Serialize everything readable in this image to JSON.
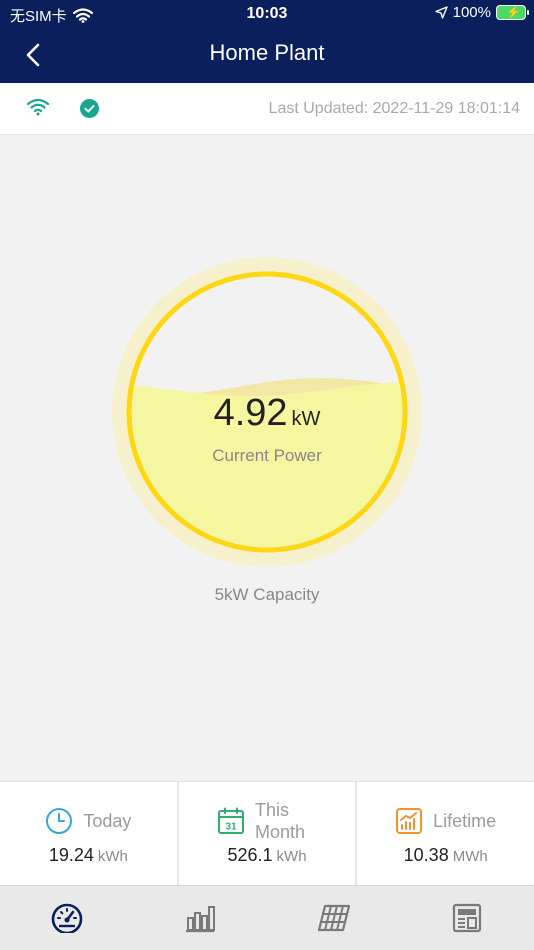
{
  "status_bar": {
    "carrier": "无SIM卡",
    "time": "10:03",
    "battery": "100%"
  },
  "header": {
    "title": "Home Plant",
    "back_icon": "chevron-left-icon"
  },
  "info_row": {
    "wifi_icon": "wifi-icon",
    "status_icon": "check-circle-icon",
    "last_updated": "Last Updated: 2022-11-29 18:01:14"
  },
  "gauge": {
    "value": "4.92",
    "unit": "kW",
    "label": "Current Power",
    "capacity": "5kW Capacity",
    "fill_fraction": 0.6,
    "ring_color": "#fcd712",
    "fill_color": "#f5f6a0"
  },
  "stats": [
    {
      "icon": "clock-icon",
      "label": "Today",
      "value": "19.24",
      "unit": "kWh",
      "color": "#35a9d4"
    },
    {
      "icon": "calendar-icon",
      "label": "This Month",
      "value": "526.1",
      "unit": "kWh",
      "color": "#2fae6e"
    },
    {
      "icon": "trending-chart-icon",
      "label": "Lifetime",
      "value": "10.38",
      "unit": "MWh",
      "color": "#f0922c"
    }
  ],
  "nav": [
    {
      "name": "dashboard",
      "icon": "speedometer-icon",
      "active": true
    },
    {
      "name": "statistics",
      "icon": "bar-chart-icon",
      "active": false
    },
    {
      "name": "solar-panels",
      "icon": "solar-panel-icon",
      "active": false
    },
    {
      "name": "news",
      "icon": "newspaper-icon",
      "active": false
    }
  ],
  "colors": {
    "header_bg": "#0a1f5c",
    "accent_teal": "#17a690",
    "nav_active": "#0a1f5c",
    "nav_inactive": "#7a7a7a"
  }
}
